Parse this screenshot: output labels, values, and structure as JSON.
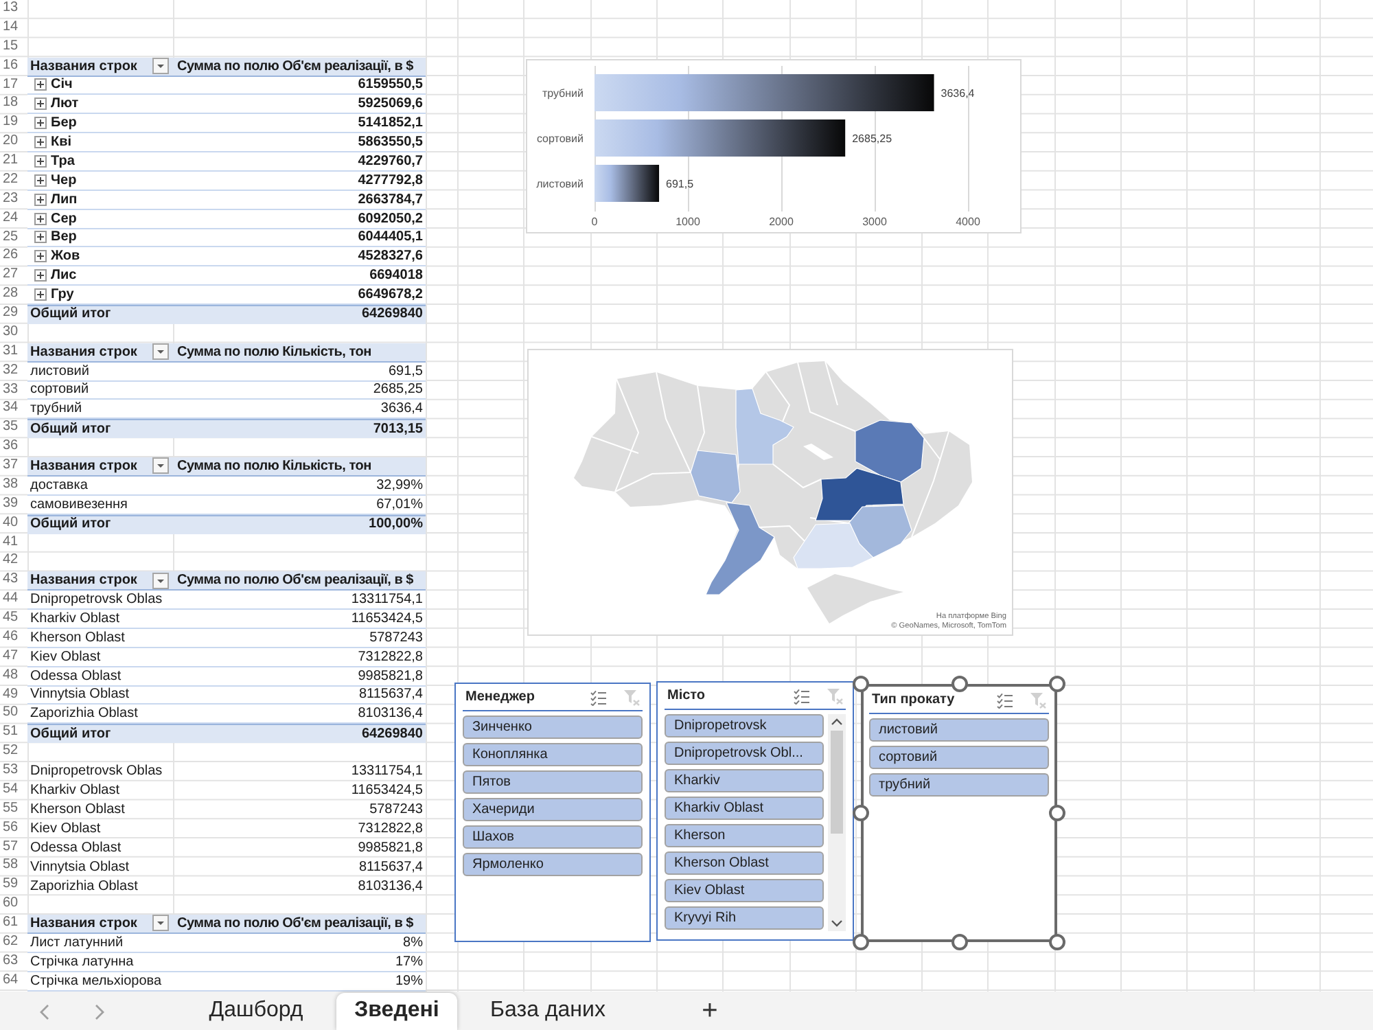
{
  "sheet": {
    "rows": [
      {
        "number": "13",
        "kind": "blank"
      },
      {
        "number": "14",
        "kind": "blank"
      },
      {
        "number": "15",
        "kind": "blank"
      },
      {
        "number": "16",
        "kind": "header",
        "label": "Названия строк",
        "value": "Сумма по полю Об'єм реалізації, в $"
      },
      {
        "number": "17",
        "kind": "group",
        "expanded": false,
        "label": "Січ",
        "value": "6159550,5"
      },
      {
        "number": "18",
        "kind": "group",
        "expanded": false,
        "label": "Лют",
        "value": "5925069,6"
      },
      {
        "number": "19",
        "kind": "group",
        "expanded": false,
        "label": "Бер",
        "value": "5141852,1"
      },
      {
        "number": "20",
        "kind": "group",
        "expanded": false,
        "label": "Кві",
        "value": "5863550,5"
      },
      {
        "number": "21",
        "kind": "group",
        "expanded": false,
        "label": "Тра",
        "value": "4229760,7"
      },
      {
        "number": "22",
        "kind": "group",
        "expanded": false,
        "label": "Чер",
        "value": "4277792,8"
      },
      {
        "number": "23",
        "kind": "group",
        "expanded": false,
        "label": "Лип",
        "value": "2663784,7"
      },
      {
        "number": "24",
        "kind": "group",
        "expanded": false,
        "label": "Сер",
        "value": "6092050,2"
      },
      {
        "number": "25",
        "kind": "group",
        "expanded": false,
        "label": "Вер",
        "value": "6044405,1"
      },
      {
        "number": "26",
        "kind": "group",
        "expanded": false,
        "label": "Жов",
        "value": "4528327,6"
      },
      {
        "number": "27",
        "kind": "group",
        "expanded": false,
        "label": "Лис",
        "value": "6694018"
      },
      {
        "number": "28",
        "kind": "group",
        "expanded": false,
        "label": "Гру",
        "value": "6649678,2"
      },
      {
        "number": "29",
        "kind": "total",
        "label": "Общий итог",
        "value": "64269840"
      },
      {
        "number": "30",
        "kind": "blank"
      },
      {
        "number": "31",
        "kind": "header",
        "label": "Названия строк",
        "value": "Сумма по полю Кількість, тон"
      },
      {
        "number": "32",
        "kind": "item",
        "label": "листовий",
        "value": "691,5"
      },
      {
        "number": "33",
        "kind": "item",
        "label": "сортовий",
        "value": "2685,25"
      },
      {
        "number": "34",
        "kind": "item",
        "label": "трубний",
        "value": "3636,4"
      },
      {
        "number": "35",
        "kind": "total",
        "label": "Общий итог",
        "value": "7013,15"
      },
      {
        "number": "36",
        "kind": "blank"
      },
      {
        "number": "37",
        "kind": "header",
        "label": "Названия строк",
        "value": "Сумма по полю Кількість, тон"
      },
      {
        "number": "38",
        "kind": "item",
        "label": "доставка",
        "value": "32,99%"
      },
      {
        "number": "39",
        "kind": "item",
        "label": "самовивезення",
        "value": "67,01%"
      },
      {
        "number": "40",
        "kind": "total",
        "label": "Общий итог",
        "value": "100,00%"
      },
      {
        "number": "41",
        "kind": "blank"
      },
      {
        "number": "42",
        "kind": "blank"
      },
      {
        "number": "43",
        "kind": "header",
        "label": "Названия строк",
        "value": "Сумма по полю Об'єм реалізації, в $"
      },
      {
        "number": "44",
        "kind": "item",
        "label": "Dnipropetrovsk Oblas",
        "value": "13311754,1"
      },
      {
        "number": "45",
        "kind": "item",
        "label": "Kharkiv Oblast",
        "value": "11653424,5"
      },
      {
        "number": "46",
        "kind": "item",
        "label": "Kherson Oblast",
        "value": "5787243"
      },
      {
        "number": "47",
        "kind": "item",
        "label": "Kiev Oblast",
        "value": "7312822,8"
      },
      {
        "number": "48",
        "kind": "item",
        "label": "Odessa Oblast",
        "value": "9985821,8"
      },
      {
        "number": "49",
        "kind": "item",
        "label": "Vinnytsia Oblast",
        "value": "8115637,4"
      },
      {
        "number": "50",
        "kind": "item",
        "label": "Zaporizhia Oblast",
        "value": "8103136,4"
      },
      {
        "number": "51",
        "kind": "total",
        "label": "Общий итог",
        "value": "64269840"
      },
      {
        "number": "52",
        "kind": "blank"
      },
      {
        "number": "53",
        "kind": "plain",
        "label": "Dnipropetrovsk Oblas",
        "value": "13311754,1"
      },
      {
        "number": "54",
        "kind": "plain",
        "label": "Kharkiv Oblast",
        "value": "11653424,5"
      },
      {
        "number": "55",
        "kind": "plain",
        "label": "Kherson Oblast",
        "value": "5787243"
      },
      {
        "number": "56",
        "kind": "plain",
        "label": "Kiev Oblast",
        "value": "7312822,8"
      },
      {
        "number": "57",
        "kind": "plain",
        "label": "Odessa Oblast",
        "value": "9985821,8"
      },
      {
        "number": "58",
        "kind": "plain",
        "label": "Vinnytsia Oblast",
        "value": "8115637,4"
      },
      {
        "number": "59",
        "kind": "plain",
        "label": "Zaporizhia Oblast",
        "value": "8103136,4"
      },
      {
        "number": "60",
        "kind": "blank"
      },
      {
        "number": "61",
        "kind": "header",
        "label": "Названия строк",
        "value": "Сумма по полю Об'єм реалізації, в $"
      },
      {
        "number": "62",
        "kind": "item",
        "label": "Лист латунний",
        "value": "8%"
      },
      {
        "number": "63",
        "kind": "item",
        "label": "Стрічка латунна",
        "value": "17%"
      },
      {
        "number": "64",
        "kind": "item",
        "label": "Стрічка мельхіорова",
        "value": "19%"
      }
    ]
  },
  "chart": {
    "chart_data": {
      "type": "bar",
      "orientation": "horizontal",
      "categories": [
        "трубний",
        "сортовий",
        "листовий"
      ],
      "values": [
        3636.4,
        2685.25,
        691.5
      ],
      "value_labels": [
        "3636,4",
        "2685,25",
        "691,5"
      ],
      "xlim": [
        0,
        4000
      ],
      "xticks": [
        0,
        1000,
        2000,
        3000,
        4000
      ],
      "grid": true
    }
  },
  "map": {
    "attribution": [
      "На платформе Bing",
      "© GeoNames, Microsoft, TomTom"
    ]
  },
  "slicers": [
    {
      "title": "Менеджер",
      "selected": false,
      "clear_filter_disabled": true,
      "scrollable": false,
      "items": [
        {
          "label": "Зинченко",
          "selected": true
        },
        {
          "label": "Коноплянка",
          "selected": true
        },
        {
          "label": "Пятов",
          "selected": true
        },
        {
          "label": "Хачериди",
          "selected": true
        },
        {
          "label": "Шахов",
          "selected": true
        },
        {
          "label": "Ярмоленко",
          "selected": true
        }
      ]
    },
    {
      "title": "Місто",
      "selected": false,
      "clear_filter_disabled": true,
      "scrollable": true,
      "items": [
        {
          "label": "Dnipropetrovsk",
          "selected": true
        },
        {
          "label": "Dnipropetrovsk Obl...",
          "selected": true
        },
        {
          "label": "Kharkiv",
          "selected": true
        },
        {
          "label": "Kharkiv Oblast",
          "selected": true
        },
        {
          "label": "Kherson",
          "selected": true
        },
        {
          "label": "Kherson Oblast",
          "selected": true
        },
        {
          "label": "Kiev Oblast",
          "selected": true
        },
        {
          "label": "Kryvyi Rih",
          "selected": true
        }
      ]
    },
    {
      "title": "Тип прокату",
      "selected": true,
      "clear_filter_disabled": true,
      "scrollable": false,
      "items": [
        {
          "label": "листовий",
          "selected": true
        },
        {
          "label": "сортовий",
          "selected": true
        },
        {
          "label": "трубний",
          "selected": true
        }
      ]
    }
  ],
  "sheet_tabs": {
    "tabs": [
      {
        "label": "Дашборд",
        "selected": false
      },
      {
        "label": "Зведені",
        "selected": true
      },
      {
        "label": "База даних",
        "selected": false
      }
    ],
    "add_button": "+"
  }
}
